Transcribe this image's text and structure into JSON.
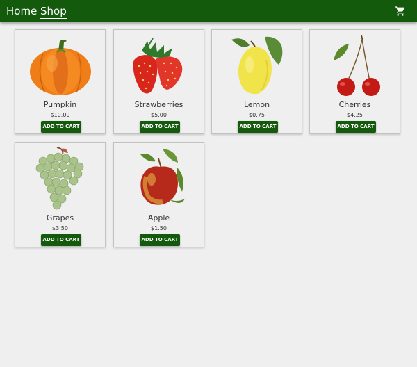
{
  "nav": {
    "home_label": "Home",
    "shop_label": "Shop",
    "cart_icon": "shopping-cart-icon"
  },
  "colors": {
    "brand_green": "#145a0c",
    "background": "#efefef"
  },
  "products": [
    {
      "name": "Pumpkin",
      "price": "$10.00",
      "button_label": "ADD TO CART",
      "image": "pumpkin-image"
    },
    {
      "name": "Strawberries",
      "price": "$5.00",
      "button_label": "ADD TO CART",
      "image": "strawberries-image"
    },
    {
      "name": "Lemon",
      "price": "$0.75",
      "button_label": "ADD TO CART",
      "image": "lemon-image"
    },
    {
      "name": "Cherries",
      "price": "$4.25",
      "button_label": "ADD TO CART",
      "image": "cherries-image"
    },
    {
      "name": "Grapes",
      "price": "$3.50",
      "button_label": "ADD TO CART",
      "image": "grapes-image"
    },
    {
      "name": "Apple",
      "price": "$1.50",
      "button_label": "ADD TO CART",
      "image": "apple-image"
    }
  ]
}
